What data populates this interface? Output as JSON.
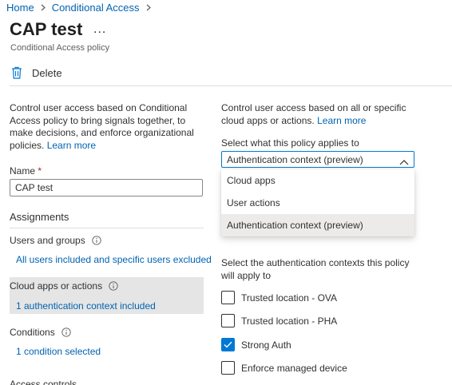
{
  "breadcrumb": {
    "home": "Home",
    "current": "Conditional Access",
    "separator": ">"
  },
  "page": {
    "title": "CAP test",
    "more": "...",
    "subtitle": "Conditional Access policy"
  },
  "toolbar": {
    "delete_label": "Delete"
  },
  "left": {
    "description": "Control user access based on Conditional Access policy to bring signals together, to make decisions, and enforce organizational policies.",
    "learn_more": "Learn more",
    "name_label": "Name",
    "name_required": "*",
    "name_value": "CAP test",
    "assignments": "Assignments",
    "users_label": "Users and groups",
    "users_value": "All users included and specific users excluded",
    "cloud_label": "Cloud apps or actions",
    "cloud_value": "1 authentication context included",
    "conditions_label": "Conditions",
    "conditions_value": "1 condition selected",
    "access_controls": "Access controls"
  },
  "right": {
    "description": "Control user access based on all or specific cloud apps or actions.",
    "learn_more": "Learn more",
    "select_label": "Select what this policy applies to",
    "select_value": "Authentication context (preview)",
    "options": [
      {
        "label": "Cloud apps",
        "selected": false
      },
      {
        "label": "User actions",
        "selected": false
      },
      {
        "label": "Authentication context (preview)",
        "selected": true
      }
    ],
    "contexts_desc": "Select the authentication contexts this policy will apply to",
    "contexts": [
      {
        "label": "Trusted location - OVA",
        "checked": false
      },
      {
        "label": "Trusted location - PHA",
        "checked": false
      },
      {
        "label": "Strong Auth",
        "checked": true
      },
      {
        "label": "Enforce managed device",
        "checked": false
      }
    ]
  },
  "colors": {
    "accent": "#0078d4",
    "link": "#0063b1",
    "selected_bg": "#e5e5e5",
    "required": "#a4262c"
  },
  "icons": [
    "chevron-right-icon",
    "more-icon",
    "trash-icon",
    "info-icon",
    "chevron-up-icon",
    "checkmark-icon"
  ]
}
